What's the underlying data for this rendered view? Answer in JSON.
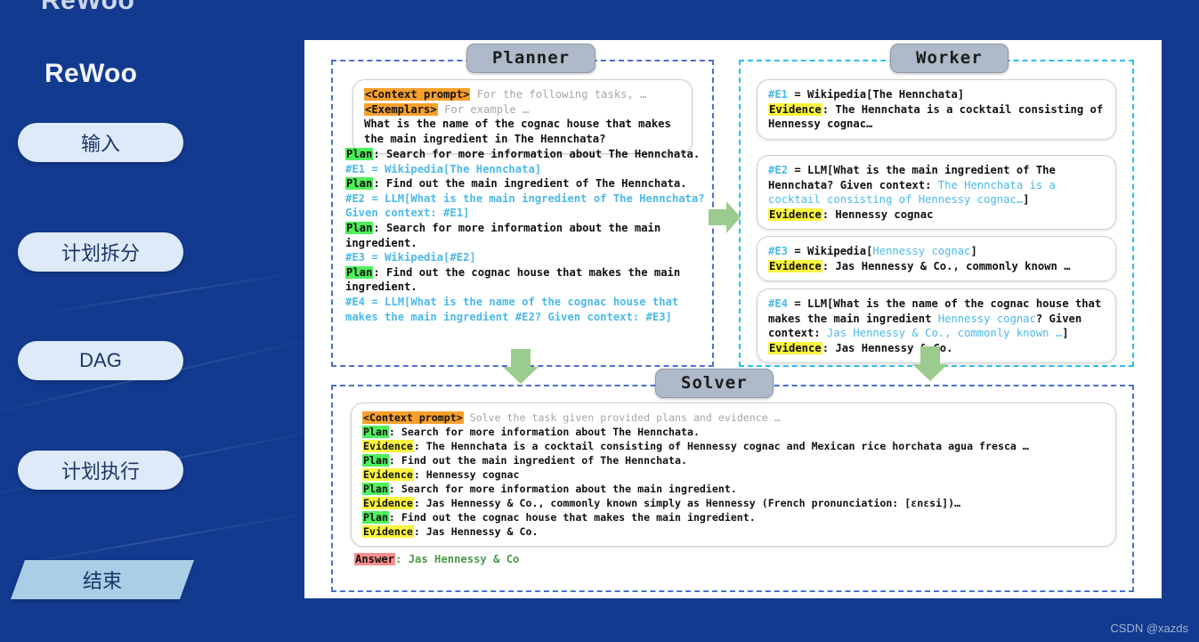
{
  "top_logo": "ReWoo",
  "watermark": "CSDN @xazds",
  "sidebar": {
    "brand": "ReWoo",
    "items": [
      {
        "label": "输入",
        "shape": "pill"
      },
      {
        "label": "计划拆分",
        "shape": "pill"
      },
      {
        "label": "DAG",
        "shape": "pill"
      },
      {
        "label": "计划执行",
        "shape": "pill"
      },
      {
        "label": "结束",
        "shape": "parallelogram"
      }
    ]
  },
  "colors": {
    "background": "#123a8f",
    "pill_fill": "#dfeaf8",
    "pill_text": "#1b3566",
    "end_fill": "#a9cee6",
    "planner_border": "#4a6fd4",
    "worker_border": "#29c0f0",
    "badge_fill": "#aeb9c9",
    "highlight_orange": "#f7a02b",
    "highlight_green": "#4ef05a",
    "highlight_yellow": "#fbf43c",
    "highlight_red": "#f98d8d",
    "reference_cyan": "#4cb9e8",
    "answer_green": "#4a9a4a",
    "arrow_green": "#9ccb8e"
  },
  "planner": {
    "title": "Planner",
    "prompt": {
      "tag_context": "<Context prompt>",
      "context_text": "For the following tasks, …",
      "tag_exemplars": "<Exemplars>",
      "exemplars_text": "For example …",
      "question": "What is the name of the cognac house that makes the main ingredient in The Hennchata?"
    },
    "plan_label": "Plan",
    "steps": [
      {
        "plan": ": Search for more information about The Hennchata.",
        "call": "#E1 = Wikipedia[The Hennchata]"
      },
      {
        "plan": ": Find out the main ingredient of The Hennchata.",
        "call": "#E2 = LLM[What is the main ingredient of The Hennchata? Given context: #E1]"
      },
      {
        "plan": ": Search for more information about the main ingredient.",
        "call": "#E3 = Wikipedia[#E2]"
      },
      {
        "plan": ": Find out the cognac house that makes the main ingredient.",
        "call": "#E4 = LLM[What is the name of the cognac house that makes the main ingredient #E2? Given context: #E3]"
      }
    ]
  },
  "worker": {
    "title": "Worker",
    "evidence_label": "Evidence",
    "cards": [
      {
        "call_prefix": "#E1",
        "call_body": " = Wikipedia[The Hennchata]",
        "evidence": ": The Hennchata is a cocktail consisting of Hennessy cognac…"
      },
      {
        "call_prefix": "#E2",
        "call_body": " = LLM[What is the main ingredient of The Hennchata? Given context: ",
        "call_ref": "The Hennchata is a cocktail consisting of Hennessy cognac…",
        "call_tail": "]",
        "evidence": ": Hennessy cognac"
      },
      {
        "call_prefix": "#E3",
        "call_body": " = Wikipedia[",
        "call_ref": "Hennessy cognac",
        "call_tail": "]",
        "evidence": ": Jas Hennessy & Co., commonly known …"
      },
      {
        "call_prefix": "#E4",
        "call_body": " = LLM[What is the name of the cognac house that makes the main ingredient ",
        "call_ref": "Hennessy cognac",
        "call_mid": "? Given context: ",
        "call_ref2": "Jas Hennessy & Co., commonly known …",
        "call_tail": "]",
        "evidence": ": Jas Hennessy & Co."
      }
    ]
  },
  "solver": {
    "title": "Solver",
    "tag_context": "<Context prompt>",
    "context_text": "Solve the task given provided plans and evidence …",
    "plan_label": "Plan",
    "evidence_label": "Evidence",
    "answer_label": "Answer",
    "lines": [
      {
        "label": "Plan",
        "text": ": Search for more information about The Hennchata."
      },
      {
        "label": "Evidence",
        "text": ": The Hennchata is a cocktail consisting of Hennessy cognac and Mexican rice horchata agua fresca …"
      },
      {
        "label": "Plan",
        "text": ": Find out the main ingredient of The Hennchata."
      },
      {
        "label": "Evidence",
        "text": ": Hennessy cognac"
      },
      {
        "label": "Plan",
        "text": ": Search for more information about the main ingredient."
      },
      {
        "label": "Evidence",
        "text": ": Jas Hennessy & Co., commonly known simply as Hennessy (French pronunciation: [ɛnɛsi])…"
      },
      {
        "label": "Plan",
        "text": ": Find out the cognac house that makes the main ingredient."
      },
      {
        "label": "Evidence",
        "text": ": Jas Hennessy & Co."
      }
    ],
    "answer_text": ": Jas Hennessy & Co"
  },
  "arrows": {
    "planner_to_worker": "arrow-right",
    "planner_to_solver": "arrow-down",
    "worker_to_solver": "arrow-down"
  }
}
